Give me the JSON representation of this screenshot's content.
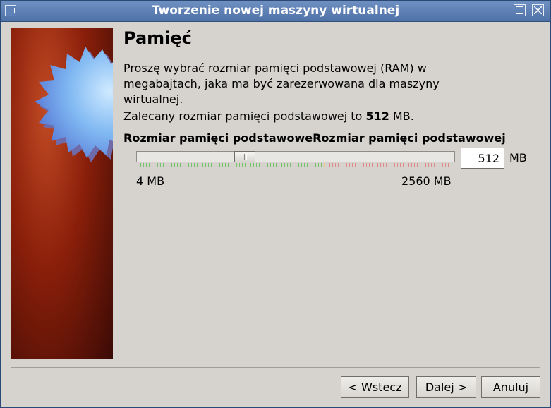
{
  "window": {
    "title": "Tworzenie nowej maszyny wirtualnej"
  },
  "page": {
    "heading": "Pamięć",
    "description": "Proszę wybrać rozmiar pamięci podstawowej (RAM) w megabajtach, jaka ma być zarezerwowana dla maszyny wirtualnej.",
    "recommend_prefix": "Zalecany rozmiar pamięci podstawowej to ",
    "recommend_value": "512",
    "recommend_suffix": " MB."
  },
  "memory": {
    "label": "Rozmiar pamięci podstawowej",
    "value": "512",
    "unit": "MB",
    "min_label": "4 MB",
    "max_label": "2560 MB",
    "min_mb": 4,
    "max_mb": 2560,
    "colors": {
      "ok": "#75c468",
      "warn": "#e8d08b",
      "bad": "#e08a8a"
    }
  },
  "buttons": {
    "back": "< Wstecz",
    "next": "Dalej >",
    "cancel": "Anuluj"
  }
}
